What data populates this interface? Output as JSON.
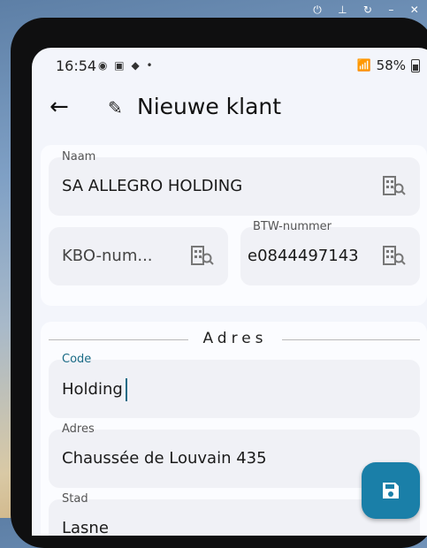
{
  "status_bar": {
    "time": "16:54",
    "battery": "58%"
  },
  "appbar": {
    "title": "Nieuwe klant"
  },
  "fields": {
    "naam": {
      "label": "Naam",
      "value": "SA ALLEGRO HOLDING"
    },
    "kbo": {
      "placeholder": "KBO-num..."
    },
    "btw": {
      "label": "BTW-nummer",
      "value": "e0844497143"
    }
  },
  "adres_section": {
    "title": "Adres",
    "code": {
      "label": "Code",
      "value": "Holding"
    },
    "adres": {
      "label": "Adres",
      "value": "Chaussée de Louvain 435"
    },
    "stad": {
      "label": "Stad",
      "value": "Lasne"
    }
  },
  "colors": {
    "accent": "#1a7fa8",
    "label_active": "#1a6b86",
    "background": "#f3f5fb"
  },
  "icons": [
    "back-arrow-icon",
    "pencil-icon",
    "building-search-icon",
    "save-icon"
  ]
}
